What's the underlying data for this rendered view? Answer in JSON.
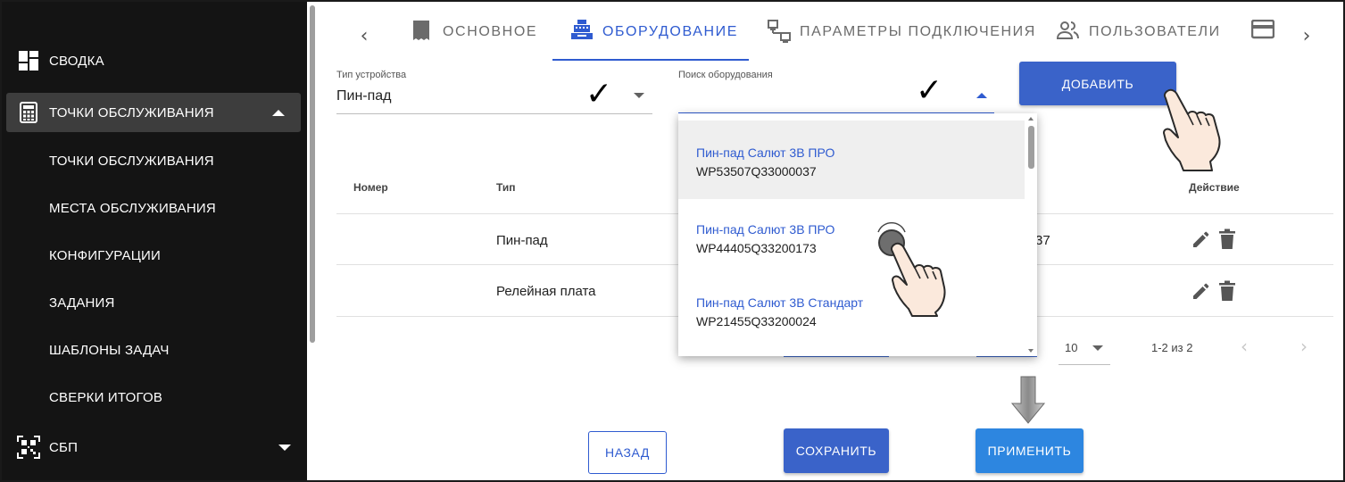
{
  "sidebar": {
    "items": [
      {
        "label": "Сводка",
        "icon": "dashboard-icon"
      },
      {
        "label": "Точки обслуживания",
        "icon": "calculator-icon",
        "expanded": true
      },
      {
        "label": "СБП",
        "icon": "qr-code-icon",
        "expanded": false
      }
    ],
    "sub_items": [
      {
        "label": "Точки обслуживания"
      },
      {
        "label": "Места обслуживания"
      },
      {
        "label": "Конфигурации"
      },
      {
        "label": "Задания"
      },
      {
        "label": "Шаблоны задач"
      },
      {
        "label": "Сверки итогов"
      }
    ]
  },
  "tabs": [
    {
      "label": "Основное",
      "icon": "document-icon",
      "active": false
    },
    {
      "label": "Оборудование",
      "icon": "cash-register-icon",
      "active": true
    },
    {
      "label": "Параметры подключения",
      "icon": "network-icon",
      "active": false
    },
    {
      "label": "Пользователи",
      "icon": "users-icon",
      "active": false
    },
    {
      "label": "",
      "icon": "card-icon",
      "active": false
    }
  ],
  "colors": {
    "accent": "#2f5bd0",
    "sidebar_bg": "#141414",
    "sidebar_active": "#3d3d3d",
    "apply_button": "#2d86e0"
  },
  "form": {
    "device_type": {
      "label": "Тип устройства",
      "value": "Пин-пад"
    },
    "search": {
      "label": "Поиск оборудования",
      "value": ""
    },
    "add_button": "Добавить"
  },
  "table": {
    "headers": {
      "number": "Номер",
      "type": "Тип",
      "action": "Действие"
    },
    "rows": [
      {
        "number": "",
        "type": "Пин-пад",
        "partial": "37"
      },
      {
        "number": "",
        "type": "Релейная плата",
        "partial": ""
      }
    ]
  },
  "pagination": {
    "per_page": "10",
    "range": "1-2 из 2"
  },
  "dropdown": {
    "items": [
      {
        "name": "Пин-пад Салют 3В ПРО",
        "serial": "WP53507Q33000037",
        "highlighted": true
      },
      {
        "name": "Пин-пад Салют 3В ПРО",
        "serial": "WP44405Q33200173",
        "highlighted": false
      },
      {
        "name": "Пин-пад Салют 3В Стандарт",
        "serial": "WP21455Q33200024",
        "highlighted": false
      }
    ]
  },
  "footer": {
    "back": "Назад",
    "save": "Сохранить",
    "apply": "Применить"
  }
}
